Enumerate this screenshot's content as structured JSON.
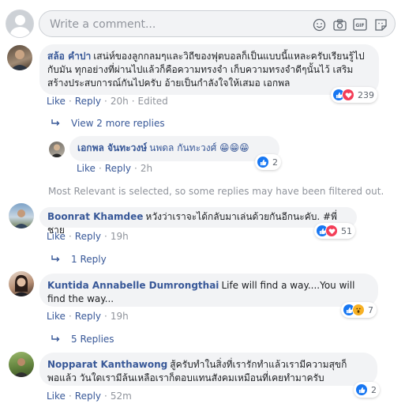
{
  "composer": {
    "placeholder": "Write a comment..."
  },
  "comments": [
    {
      "name": "สล้อ คำปา",
      "text": "เสน่ห์ของลูกกลมๆและวิถีของฟุตบอลก็เป็นแบบนี้แหละครับเรียนรู้ไปกับมัน ทุกอย่างที่ผ่านไปแล้วก็คือความทรงจำ เก็บความทรงจำดีๆนั้นไว้ เสริมสร้างประสบการณ์กันไปครับ อ้ายเป็นกำลังใจให้เสมอ เอกพล",
      "like": "Like",
      "reply": "Reply",
      "time": "20h",
      "edited": "Edited",
      "reactions": "239",
      "more_replies": "View 2 more replies"
    },
    {
      "name": "เอกพล จันทะวงษ์",
      "text": "นพดล กันทะวงศ์ 😁😁😁",
      "like": "Like",
      "reply": "Reply",
      "time": "2h",
      "reactions": "2"
    },
    {
      "name": "Boonrat Khamdee",
      "text": "หวังว่าเราจะได้กลับมาเล่นด้วยกันอีกนะคับ. #พี่ชาย",
      "like": "Like",
      "reply": "Reply",
      "time": "19h",
      "reactions": "51",
      "more_replies": "1 Reply"
    },
    {
      "name": "Kuntida Annabelle Dumrongthai",
      "text": "Life will find a way....You will find the way...",
      "like": "Like",
      "reply": "Reply",
      "time": "19h",
      "reactions": "7",
      "more_replies": "5 Replies"
    },
    {
      "name": "Nopparat Kanthawong",
      "text": "สู้ครับทำในสิ่งที่เรารักทำแล้วเรามีความสุขก็พอแล้ว วันใดเรามีล้นเหลือเราก็ตอบแทนสังคมเหมือนที่เคยทำมาครับ",
      "like": "Like",
      "reply": "Reply",
      "time": "52m",
      "reactions": "2"
    }
  ],
  "notice": "Most Relevant is selected, so some replies may have been filtered out.",
  "colors": {
    "link": "#385898",
    "bubble": "#f2f3f5",
    "meta": "#90949c",
    "like": "#1877f2",
    "love": "#f33e58"
  },
  "icons": [
    "emoji-icon",
    "camera-icon",
    "gif-icon",
    "sticker-icon"
  ]
}
